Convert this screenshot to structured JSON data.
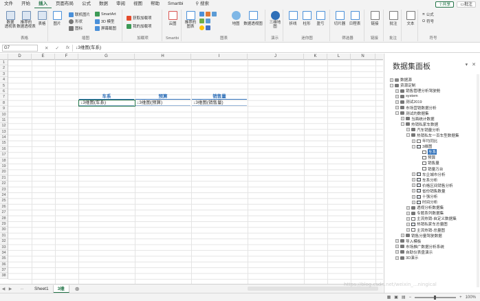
{
  "menu": {
    "tabs": [
      "文件",
      "开始",
      "插入",
      "页面布局",
      "公式",
      "数据",
      "审阅",
      "视图",
      "帮助",
      "Smartbi"
    ],
    "active": "插入",
    "search": "搜索",
    "share": "共享",
    "comment": "批注"
  },
  "ribbon": {
    "groups": {
      "tables": "表格",
      "illustrations": "插图",
      "addins": "加载项",
      "smartbi": "Smartbi",
      "charts": "图表",
      "tours": "演示",
      "sparklines": "迷你图",
      "filters": "筛选器",
      "links": "链接",
      "comments": "批注",
      "symbols": "符号"
    },
    "buttons": {
      "pivot": "数据\n透视表",
      "rec_pivot": "推荐的\n数据透视表",
      "table": "表格",
      "picture": "图片",
      "online_pic": "联机图片",
      "shapes": "形状",
      "icons": "图标",
      "smartart": "SmartArt",
      "model3d": "3D 模型",
      "screenshot": "屏幕截图",
      "get_addins": "获取加载项",
      "my_addins": "我的加载项",
      "cloud_chart": "云图",
      "rec_charts": "推荐的\n图表",
      "map": "地图",
      "pivotchart": "数据透视图",
      "map3d": "三维地\n图",
      "line": "折线",
      "column": "柱形",
      "winloss": "盈亏",
      "slicer": "切片器",
      "timeline": "日程表",
      "link": "链接",
      "comment": "批注",
      "text": "文本",
      "equation": "公式",
      "symbol": "符号"
    }
  },
  "formula_bar": {
    "name_box": "G7",
    "fx": "fx",
    "content": "↓3维图(车系)"
  },
  "grid": {
    "columns": [
      "D",
      "E",
      "F",
      "G",
      "H",
      "I",
      "J",
      "K",
      "L",
      "N"
    ],
    "rows": [
      "1",
      "2",
      "3",
      "4",
      "5",
      "6",
      "7",
      "8",
      "9",
      "10",
      "11",
      "12",
      "13",
      "14",
      "15",
      "16",
      "17",
      "18",
      "19",
      "20",
      "21",
      "22",
      "23",
      "24",
      "25",
      "26",
      "27",
      "28",
      "29",
      "30",
      "31",
      "32",
      "33",
      "34",
      "35",
      "36",
      "37",
      "38"
    ],
    "headers": [
      "车系",
      "预算",
      "销售量"
    ],
    "values": [
      "↓3维图(车系)",
      "↓3维图(预算)",
      "↓3维图(销售量)"
    ]
  },
  "sheets": {
    "tabs": [
      "Sheet1",
      "3维"
    ],
    "active": "3维",
    "nav_prev": "◀",
    "nav_next": "▶",
    "more": "...",
    "add": "⊕"
  },
  "status": {
    "zoom": "100%",
    "minus": "−",
    "plus": "+"
  },
  "panel": {
    "title": "数据集面板",
    "controls": [
      "▾",
      "✕"
    ],
    "tree": [
      {
        "label": "数据源",
        "lvl": 0,
        "tg": "+",
        "ico": "db"
      },
      {
        "label": "资源定制",
        "lvl": 0,
        "tg": "−",
        "ico": "folder"
      },
      {
        "label": "销售管理分析驾驶舱",
        "lvl": 1,
        "tg": "+",
        "ico": "folder"
      },
      {
        "label": "system",
        "lvl": 1,
        "tg": "+",
        "ico": "folder"
      },
      {
        "label": "测试2019",
        "lvl": 1,
        "tg": "+",
        "ico": "folder"
      },
      {
        "label": "市场营销数据分析",
        "lvl": 1,
        "tg": "+",
        "ico": "folder"
      },
      {
        "label": "测试的数据集",
        "lvl": 1,
        "tg": "−",
        "ico": "folder"
      },
      {
        "label": "当面统计数据",
        "lvl": 2,
        "tg": "+",
        "ico": "folder"
      },
      {
        "label": "热销私家车数据",
        "lvl": 2,
        "tg": "−",
        "ico": "folder"
      },
      {
        "label": "汽车销量分析",
        "lvl": 3,
        "tg": "+",
        "ico": "folder"
      },
      {
        "label": "热销私车一百车型数据集",
        "lvl": 3,
        "tg": "−",
        "ico": "folder"
      },
      {
        "label": "年均同比",
        "lvl": 4,
        "tg": "+",
        "ico": "sheet"
      },
      {
        "label": "3维图",
        "lvl": 4,
        "tg": "−",
        "ico": "chart"
      },
      {
        "label": "车系",
        "lvl": 5,
        "tg": "",
        "ico": "sheet",
        "sel": true
      },
      {
        "label": "预算",
        "lvl": 5,
        "tg": "",
        "ico": "sheet"
      },
      {
        "label": "销售量",
        "lvl": 5,
        "tg": "",
        "ico": "sheet"
      },
      {
        "label": "销量万台",
        "lvl": 5,
        "tg": "",
        "ico": "sheet"
      },
      {
        "label": "车企城市分析",
        "lvl": 4,
        "tg": "+",
        "ico": "chart"
      },
      {
        "label": "车系分析",
        "lvl": 4,
        "tg": "+",
        "ico": "chart"
      },
      {
        "label": "价格区间销售分析",
        "lvl": 4,
        "tg": "+",
        "ico": "chart"
      },
      {
        "label": "省份销售数量",
        "lvl": 4,
        "tg": "+",
        "ico": "chart"
      },
      {
        "label": "十强分析",
        "lvl": 4,
        "tg": "+",
        "ico": "chart"
      },
      {
        "label": "时间分析",
        "lvl": 4,
        "tg": "+",
        "ico": "chart"
      },
      {
        "label": "透视分析数据集",
        "lvl": 3,
        "tg": "+",
        "ico": "folder"
      },
      {
        "label": "专题系列数据集",
        "lvl": 3,
        "tg": "+",
        "ico": "folder"
      },
      {
        "label": "主流热销-自定义数据集",
        "lvl": 3,
        "tg": "+",
        "ico": "sheet"
      },
      {
        "label": "热销私家车总量图",
        "lvl": 3,
        "tg": "+",
        "ico": "chart"
      },
      {
        "label": "主流热销-总量图",
        "lvl": 3,
        "tg": "+",
        "ico": "sheet"
      },
      {
        "label": "销售分量驾驶数据",
        "lvl": 2,
        "tg": "+",
        "ico": "folder"
      },
      {
        "label": "导入模板",
        "lvl": 1,
        "tg": "+",
        "ico": "folder"
      },
      {
        "label": "市场推广数据分析系统",
        "lvl": 1,
        "tg": "+",
        "ico": "folder"
      },
      {
        "label": "自助仪表盘演示",
        "lvl": 1,
        "tg": "+",
        "ico": "folder"
      },
      {
        "label": "3D演示",
        "lvl": 1,
        "tg": "+",
        "ico": "folder"
      }
    ]
  },
  "watermark": "https://blog.csdn.net/weixin_...ningical"
}
